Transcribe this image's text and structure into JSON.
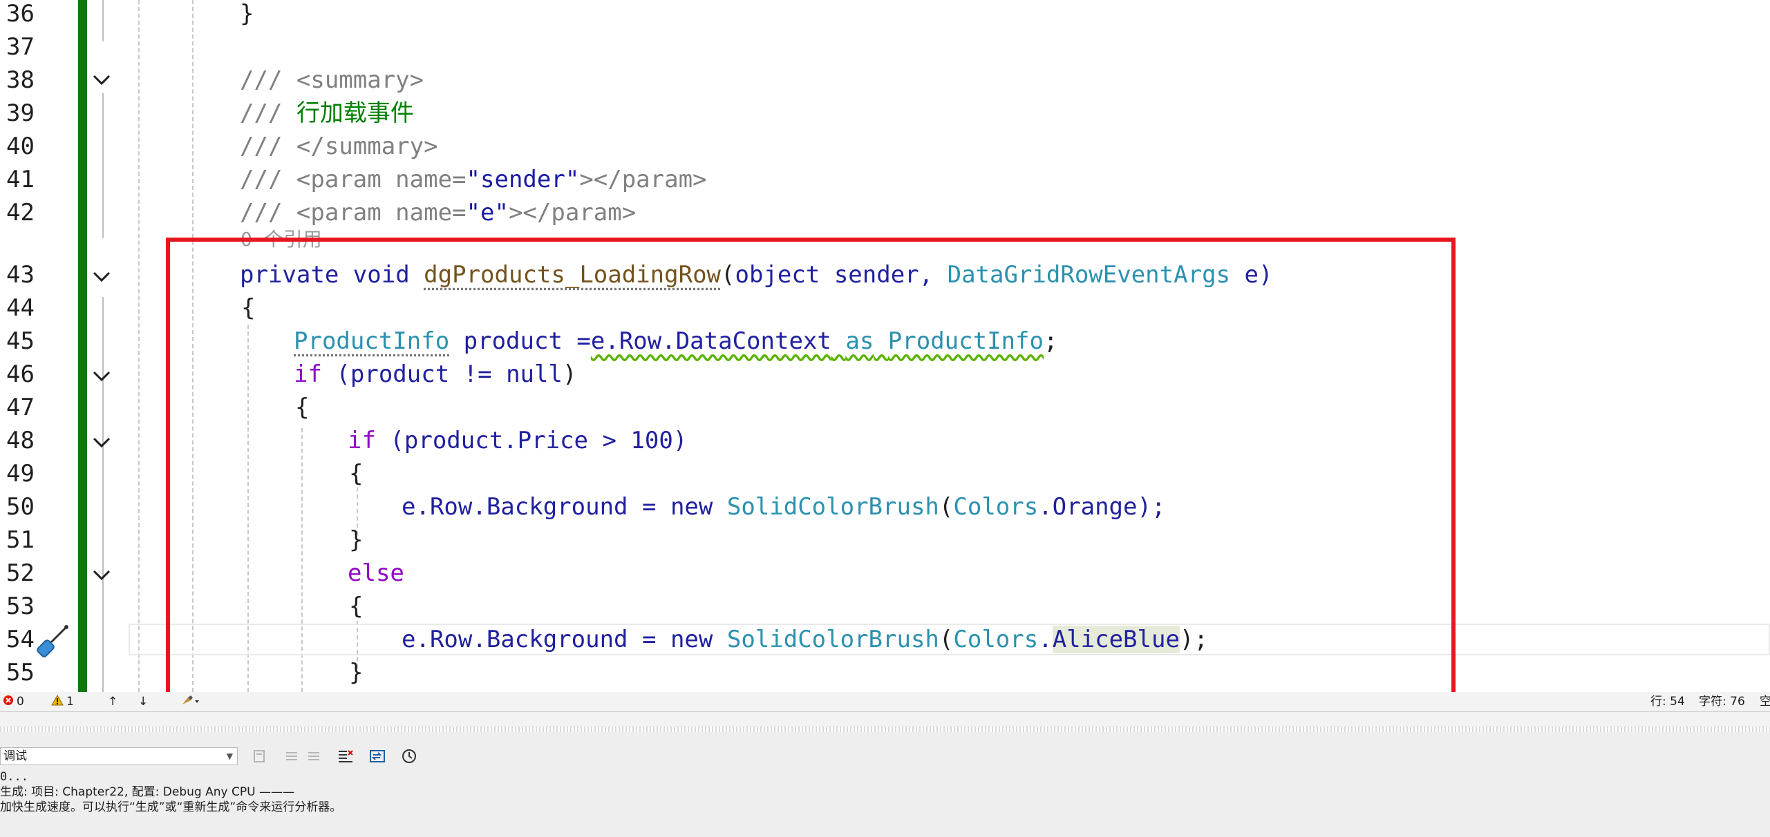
{
  "editor": {
    "lines": [
      {
        "num": "36",
        "code": "}"
      },
      {
        "num": "37",
        "code": ""
      },
      {
        "num": "38",
        "code": "/// <summary>"
      },
      {
        "num": "39",
        "code": "/// 行加载事件"
      },
      {
        "num": "40",
        "code": "/// </summary>"
      },
      {
        "num": "41",
        "code": "/// <param name=\"sender\"></param>"
      },
      {
        "num": "42",
        "code": "/// <param name=\"e\"></param>"
      },
      {
        "num": "43",
        "code": "private void dgProducts_LoadingRow(object sender, DataGridRowEventArgs e)"
      },
      {
        "num": "44",
        "code": "{"
      },
      {
        "num": "45",
        "code": "ProductInfo product =e.Row.DataContext as ProductInfo;"
      },
      {
        "num": "46",
        "code": "if (product != null)"
      },
      {
        "num": "47",
        "code": "{"
      },
      {
        "num": "48",
        "code": "if (product.Price > 100)"
      },
      {
        "num": "49",
        "code": "{"
      },
      {
        "num": "50",
        "code": "e.Row.Background = new SolidColorBrush(Colors.Orange);"
      },
      {
        "num": "51",
        "code": "}"
      },
      {
        "num": "52",
        "code": "else"
      },
      {
        "num": "53",
        "code": "{"
      },
      {
        "num": "54",
        "code": "e.Row.Background = new SolidColorBrush(Colors.AliceBlue);"
      },
      {
        "num": "55",
        "code": "}"
      }
    ],
    "reference_hint": "0 个引用",
    "tokens": {
      "summary_open": "/// <summary>",
      "comment_prefix": "/// ",
      "summary_text": "行加载事件",
      "summary_close": "/// </summary>",
      "param_open": "<param name=",
      "param_sender": "\"sender\"",
      "param_e": "\"e\"",
      "param_close": "></param>",
      "private": "private",
      "void": "void",
      "method": "dgProducts_LoadingRow",
      "object": "object",
      "sender": "sender,",
      "args_type": "DataGridRowEventArgs",
      "e_param": "e)",
      "paren_open": "(",
      "brace_open": "{",
      "brace_close": "}",
      "productinfo": "ProductInfo",
      "product_decl": " product =",
      "e_row_ctx": "e.Row.DataContext",
      "as": "as",
      "semicolon": ";",
      "if": "if",
      "cond1": " (product != ",
      "null": "null",
      "close_paren": ")",
      "cond2": " (product.Price > 100)",
      "assign": "e.Row.Background = ",
      "new": "new",
      "brush": "SolidColorBrush",
      "colors": "Colors",
      "orange": ".Orange);",
      "dot": ".",
      "aliceblue": "AliceBlue",
      "end_call": ");",
      "else": "else"
    }
  },
  "status": {
    "errors": "0",
    "warnings": "1",
    "line_label": "行: 54",
    "char_label": "字符: 76",
    "overflow": "空"
  },
  "output": {
    "source_selected": "调试",
    "lines": [
      "0...",
      "生成: 项目: Chapter22, 配置: Debug Any CPU ———",
      "加快生成速度。可以执行“生成”或“重新生成”命令来运行分析器。"
    ]
  },
  "colors": {
    "highlight_box": "#e8161f",
    "change_bar": "#0b7a0b"
  }
}
